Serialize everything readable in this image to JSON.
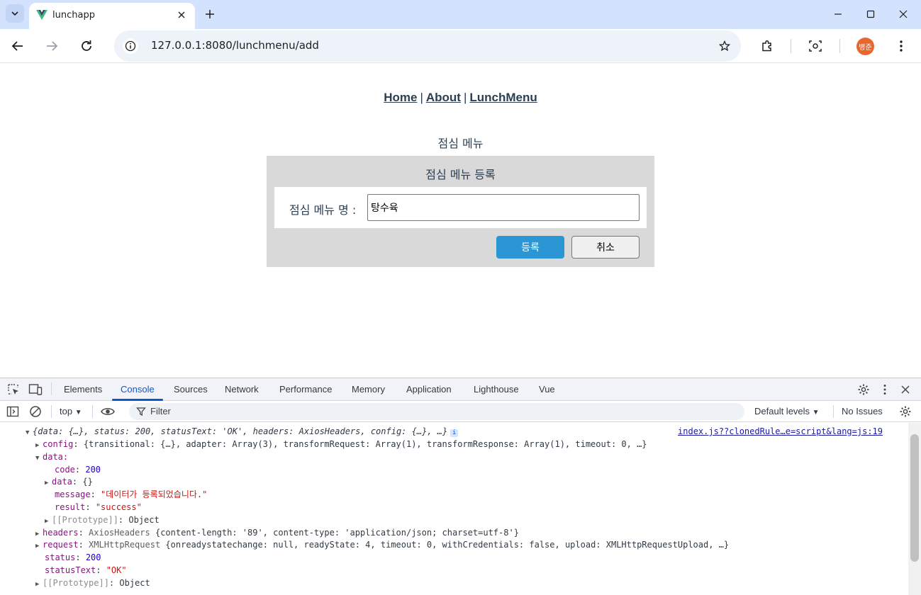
{
  "browser": {
    "tab_title": "lunchapp",
    "url": "127.0.0.1:8080/lunchmenu/add",
    "profile_initials": "병준"
  },
  "site": {
    "nav": [
      "Home",
      "About",
      "LunchMenu"
    ],
    "nav_sep": "|",
    "page_heading": "점심 메뉴",
    "form": {
      "title": "점심 메뉴 등록",
      "label": "점심 메뉴 명 :",
      "input_value": "탕수육",
      "submit_label": "등록",
      "cancel_label": "취소"
    }
  },
  "devtools": {
    "tabs": [
      "Elements",
      "Console",
      "Sources",
      "Network",
      "Performance",
      "Memory",
      "Application",
      "Lighthouse",
      "Vue"
    ],
    "active_tab": "Console",
    "context": "top",
    "filter_placeholder": "Filter",
    "levels": "Default levels",
    "issues": "No Issues",
    "source_link": "index.js??clonedRule…e=script&lang=js:19",
    "log": {
      "summary": "{data: {…}, status: 200, statusText: 'OK', headers: AxiosHeaders, config: {…}, …}",
      "config": "{transitional: {…}, adapter: Array(3), transformRequest: Array(1), transformResponse: Array(1), timeout: 0, …}",
      "data_key": "data:",
      "code": "200",
      "data_inner": "{}",
      "message": "\"데이터가 등록되었습니다.\"",
      "result": "\"success\"",
      "proto_obj": "Object",
      "headers_type": "AxiosHeaders",
      "headers": "{content-length: '89', content-type: 'application/json; charset=utf-8'}",
      "request_type": "XMLHttpRequest",
      "request": "{onreadystatechange: null, readyState: 4, timeout: 0, withCredentials: false, upload: XMLHttpRequestUpload, …}",
      "status": "200",
      "statusText": "\"OK\"",
      "proto_root": "Object"
    }
  },
  "colors": {
    "tabstrip": "#d3e3fd",
    "accent": "#0b57d0",
    "submit_button": "#2a97d4",
    "avatar": "#e8672f",
    "form_box": "#d9d9d9"
  }
}
